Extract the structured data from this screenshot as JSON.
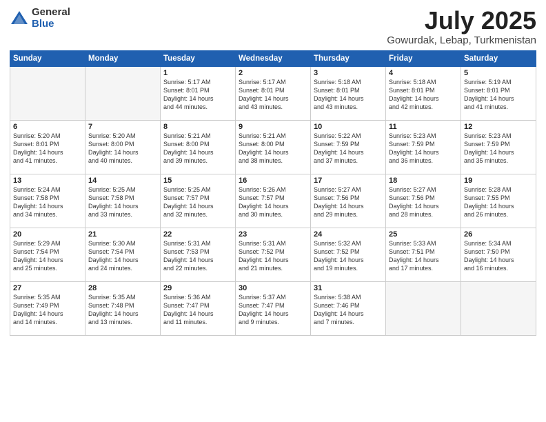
{
  "header": {
    "logo_general": "General",
    "logo_blue": "Blue",
    "month_title": "July 2025",
    "location": "Gowurdak, Lebap, Turkmenistan"
  },
  "weekdays": [
    "Sunday",
    "Monday",
    "Tuesday",
    "Wednesday",
    "Thursday",
    "Friday",
    "Saturday"
  ],
  "weeks": [
    [
      {
        "day": "",
        "info": ""
      },
      {
        "day": "",
        "info": ""
      },
      {
        "day": "1",
        "info": "Sunrise: 5:17 AM\nSunset: 8:01 PM\nDaylight: 14 hours\nand 44 minutes."
      },
      {
        "day": "2",
        "info": "Sunrise: 5:17 AM\nSunset: 8:01 PM\nDaylight: 14 hours\nand 43 minutes."
      },
      {
        "day": "3",
        "info": "Sunrise: 5:18 AM\nSunset: 8:01 PM\nDaylight: 14 hours\nand 43 minutes."
      },
      {
        "day": "4",
        "info": "Sunrise: 5:18 AM\nSunset: 8:01 PM\nDaylight: 14 hours\nand 42 minutes."
      },
      {
        "day": "5",
        "info": "Sunrise: 5:19 AM\nSunset: 8:01 PM\nDaylight: 14 hours\nand 41 minutes."
      }
    ],
    [
      {
        "day": "6",
        "info": "Sunrise: 5:20 AM\nSunset: 8:01 PM\nDaylight: 14 hours\nand 41 minutes."
      },
      {
        "day": "7",
        "info": "Sunrise: 5:20 AM\nSunset: 8:00 PM\nDaylight: 14 hours\nand 40 minutes."
      },
      {
        "day": "8",
        "info": "Sunrise: 5:21 AM\nSunset: 8:00 PM\nDaylight: 14 hours\nand 39 minutes."
      },
      {
        "day": "9",
        "info": "Sunrise: 5:21 AM\nSunset: 8:00 PM\nDaylight: 14 hours\nand 38 minutes."
      },
      {
        "day": "10",
        "info": "Sunrise: 5:22 AM\nSunset: 7:59 PM\nDaylight: 14 hours\nand 37 minutes."
      },
      {
        "day": "11",
        "info": "Sunrise: 5:23 AM\nSunset: 7:59 PM\nDaylight: 14 hours\nand 36 minutes."
      },
      {
        "day": "12",
        "info": "Sunrise: 5:23 AM\nSunset: 7:59 PM\nDaylight: 14 hours\nand 35 minutes."
      }
    ],
    [
      {
        "day": "13",
        "info": "Sunrise: 5:24 AM\nSunset: 7:58 PM\nDaylight: 14 hours\nand 34 minutes."
      },
      {
        "day": "14",
        "info": "Sunrise: 5:25 AM\nSunset: 7:58 PM\nDaylight: 14 hours\nand 33 minutes."
      },
      {
        "day": "15",
        "info": "Sunrise: 5:25 AM\nSunset: 7:57 PM\nDaylight: 14 hours\nand 32 minutes."
      },
      {
        "day": "16",
        "info": "Sunrise: 5:26 AM\nSunset: 7:57 PM\nDaylight: 14 hours\nand 30 minutes."
      },
      {
        "day": "17",
        "info": "Sunrise: 5:27 AM\nSunset: 7:56 PM\nDaylight: 14 hours\nand 29 minutes."
      },
      {
        "day": "18",
        "info": "Sunrise: 5:27 AM\nSunset: 7:56 PM\nDaylight: 14 hours\nand 28 minutes."
      },
      {
        "day": "19",
        "info": "Sunrise: 5:28 AM\nSunset: 7:55 PM\nDaylight: 14 hours\nand 26 minutes."
      }
    ],
    [
      {
        "day": "20",
        "info": "Sunrise: 5:29 AM\nSunset: 7:54 PM\nDaylight: 14 hours\nand 25 minutes."
      },
      {
        "day": "21",
        "info": "Sunrise: 5:30 AM\nSunset: 7:54 PM\nDaylight: 14 hours\nand 24 minutes."
      },
      {
        "day": "22",
        "info": "Sunrise: 5:31 AM\nSunset: 7:53 PM\nDaylight: 14 hours\nand 22 minutes."
      },
      {
        "day": "23",
        "info": "Sunrise: 5:31 AM\nSunset: 7:52 PM\nDaylight: 14 hours\nand 21 minutes."
      },
      {
        "day": "24",
        "info": "Sunrise: 5:32 AM\nSunset: 7:52 PM\nDaylight: 14 hours\nand 19 minutes."
      },
      {
        "day": "25",
        "info": "Sunrise: 5:33 AM\nSunset: 7:51 PM\nDaylight: 14 hours\nand 17 minutes."
      },
      {
        "day": "26",
        "info": "Sunrise: 5:34 AM\nSunset: 7:50 PM\nDaylight: 14 hours\nand 16 minutes."
      }
    ],
    [
      {
        "day": "27",
        "info": "Sunrise: 5:35 AM\nSunset: 7:49 PM\nDaylight: 14 hours\nand 14 minutes."
      },
      {
        "day": "28",
        "info": "Sunrise: 5:35 AM\nSunset: 7:48 PM\nDaylight: 14 hours\nand 13 minutes."
      },
      {
        "day": "29",
        "info": "Sunrise: 5:36 AM\nSunset: 7:47 PM\nDaylight: 14 hours\nand 11 minutes."
      },
      {
        "day": "30",
        "info": "Sunrise: 5:37 AM\nSunset: 7:47 PM\nDaylight: 14 hours\nand 9 minutes."
      },
      {
        "day": "31",
        "info": "Sunrise: 5:38 AM\nSunset: 7:46 PM\nDaylight: 14 hours\nand 7 minutes."
      },
      {
        "day": "",
        "info": ""
      },
      {
        "day": "",
        "info": ""
      }
    ]
  ]
}
